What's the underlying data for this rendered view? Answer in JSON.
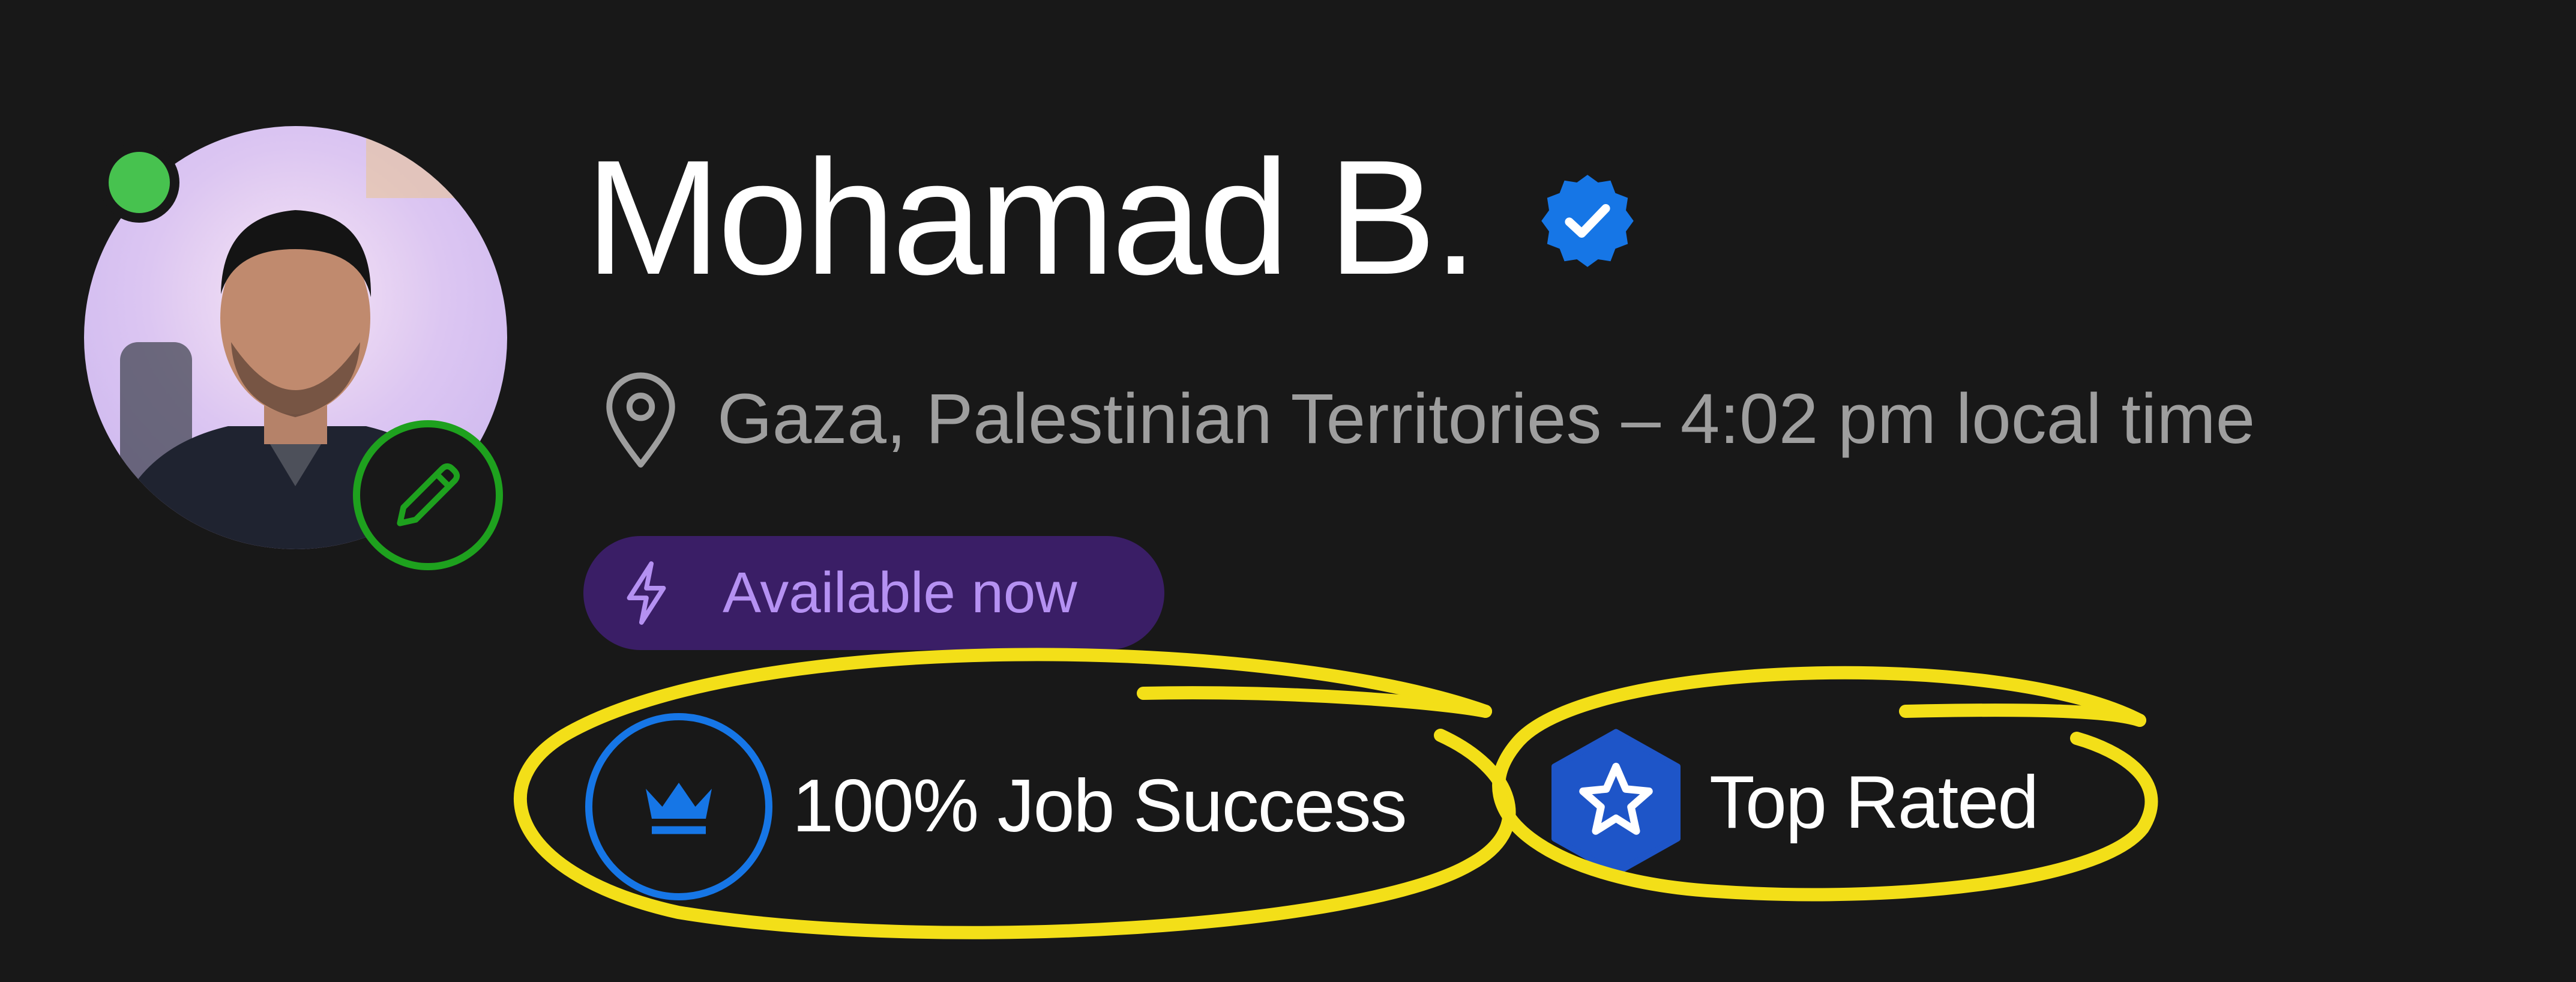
{
  "profile": {
    "name": "Mohamad B.",
    "location": "Gaza, Palestinian Territories – 4:02 pm local time",
    "availability_label": "Available now",
    "online": true
  },
  "badges": {
    "job_success": "100% Job Success",
    "top_rated": "Top Rated"
  },
  "icons": {
    "verified": "verified-badge-icon",
    "location": "map-pin-icon",
    "availability": "lightning-bolt-icon",
    "edit": "pencil-icon",
    "job_success": "crown-icon",
    "top_rated": "star-hexagon-icon"
  },
  "colors": {
    "background": "#181818",
    "online_dot": "#47c24f",
    "edit_ring": "#1ea11e",
    "verified": "#1676e6",
    "availability_bg": "#3a1e66",
    "availability_text": "#b591f2",
    "top_rated_badge": "#1e55c8",
    "annotation": "#f3df18"
  }
}
